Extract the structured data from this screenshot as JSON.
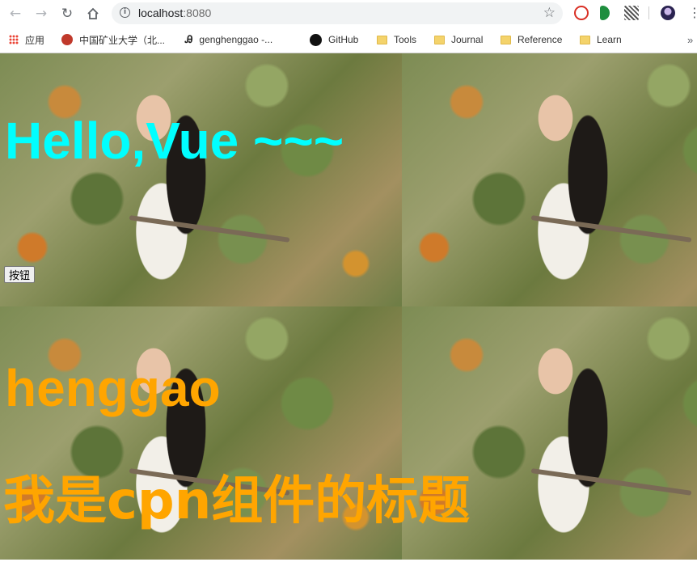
{
  "browser": {
    "url_host": "localhost",
    "url_port": ":8080"
  },
  "bookmarks": [
    {
      "label": "应用",
      "icon": "apps-grid-icon"
    },
    {
      "label": "中国矿业大学（北...",
      "icon": "university-logo-icon"
    },
    {
      "label": "genghenggao -...",
      "icon": "profile-icon"
    },
    {
      "label": "GitHub",
      "icon": "github-icon"
    },
    {
      "label": "Tools",
      "icon": "folder-icon"
    },
    {
      "label": "Journal",
      "icon": "folder-icon"
    },
    {
      "label": "Reference",
      "icon": "folder-icon"
    },
    {
      "label": "Learn",
      "icon": "folder-icon"
    }
  ],
  "page": {
    "hello_title": "Hello,Vue ~~~",
    "button_label": "按钮",
    "name_text": "henggao",
    "cpn_title": "我是cpn组件的标题"
  },
  "colors": {
    "hello": "#00ffff",
    "orange": "#ffa500"
  }
}
